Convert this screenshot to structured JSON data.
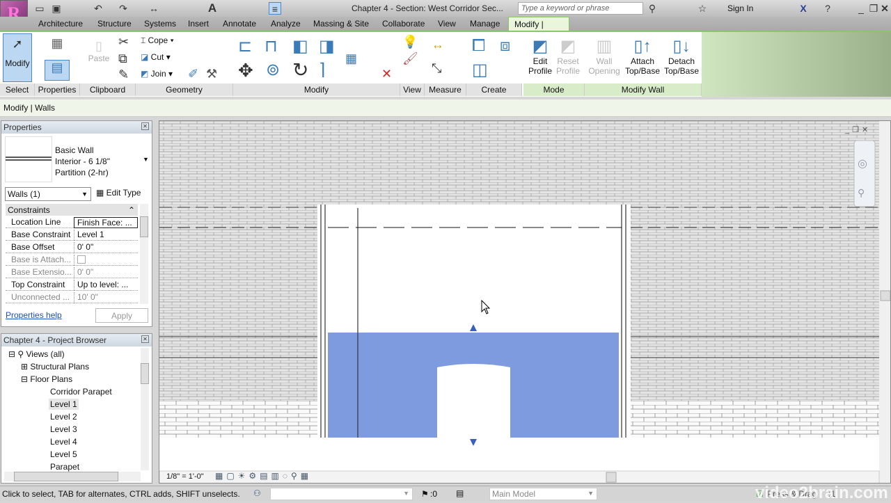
{
  "title": {
    "document": "Chapter 4 - Section: West Corridor Sec...",
    "search_placeholder": "Type a keyword or phrase",
    "sign_in": "Sign In"
  },
  "tabs": [
    "Architecture",
    "Structure",
    "Systems",
    "Insert",
    "Annotate",
    "Analyze",
    "Massing & Site",
    "Collaborate",
    "View",
    "Manage",
    "Modify | Walls"
  ],
  "ribbon": {
    "select": {
      "modify": "Modify",
      "label": "Select"
    },
    "properties": {
      "label": "Properties"
    },
    "clipboard": {
      "paste": "Paste",
      "label": "Clipboard"
    },
    "geometry": {
      "cope": "Cope",
      "cut": "Cut",
      "join": "Join",
      "label": "Geometry"
    },
    "modify": {
      "label": "Modify"
    },
    "view": {
      "label": "View"
    },
    "measure": {
      "label": "Measure"
    },
    "create": {
      "label": "Create"
    },
    "mode": {
      "edit_profile_1": "Edit",
      "edit_profile_2": "Profile",
      "reset_profile_1": "Reset",
      "reset_profile_2": "Profile",
      "label": "Mode"
    },
    "modify_wall": {
      "wall_opening_1": "Wall",
      "wall_opening_2": "Opening",
      "attach_1": "Attach",
      "attach_2": "Top/Base",
      "detach_1": "Detach",
      "detach_2": "Top/Base",
      "label": "Modify Wall"
    }
  },
  "options_bar": "Modify | Walls",
  "properties": {
    "title": "Properties",
    "type_line1": "Basic Wall",
    "type_line2": "Interior - 6 1/8\"",
    "type_line3": "Partition (2-hr)",
    "filter": "Walls (1)",
    "edit_type": "Edit Type",
    "group": "Constraints",
    "rows": [
      {
        "k": "Location Line",
        "v": "Finish Face: ..."
      },
      {
        "k": "Base Constraint",
        "v": "Level 1"
      },
      {
        "k": "Base Offset",
        "v": "0'  0\""
      },
      {
        "k": "Base is Attach...",
        "v": ""
      },
      {
        "k": "Base Extensio...",
        "v": "0'  0\""
      },
      {
        "k": "Top Constraint",
        "v": "Up to level: ..."
      },
      {
        "k": "Unconnected ...",
        "v": "10'  0\""
      }
    ],
    "help": "Properties help",
    "apply": "Apply"
  },
  "browser": {
    "title": "Chapter 4 - Project Browser",
    "items": [
      "Views (all)",
      "Structural Plans",
      "Floor Plans",
      "Corridor Parapet",
      "Level 1",
      "Level 2",
      "Level 3",
      "Level 4",
      "Level 5",
      "Parapet"
    ]
  },
  "view_bar": {
    "scale": "1/8\" = 1'-0\""
  },
  "status": {
    "hint": "Click to select, TAB for alternates, CTRL adds, SHIFT unselects.",
    "count": ":0",
    "model": "Main Model",
    "press_drag": "Press & Drag",
    "filter_count": ":1",
    "watermark": "video2brain.com"
  },
  "colors": {
    "selection": "#7f9bdf",
    "ribbon_accent": "#8ac66a"
  }
}
